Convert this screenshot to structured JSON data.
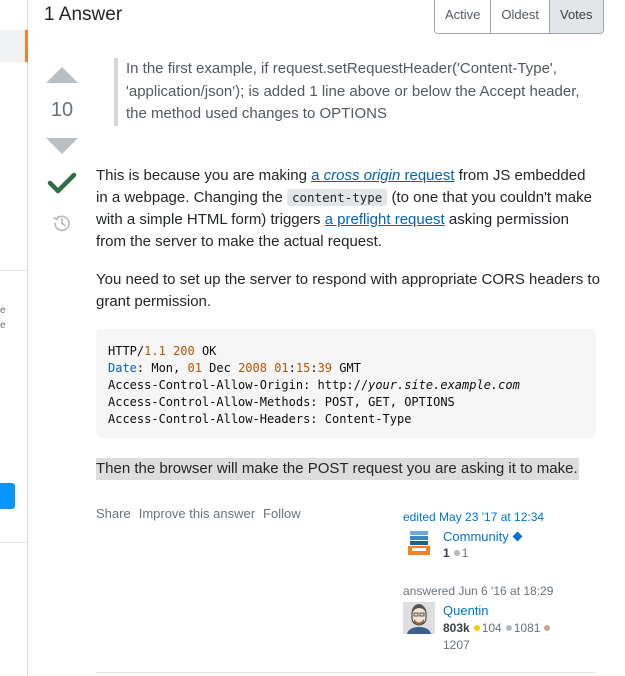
{
  "header": {
    "answers_count": "1 Answer",
    "sort_tabs": [
      "Active",
      "Oldest",
      "Votes"
    ],
    "selected_sort": "Votes"
  },
  "sidebar": {
    "fragment_1": "e",
    "fragment_2": "e"
  },
  "answer": {
    "score": "10",
    "accepted": true,
    "quote": "In the first example, if request.setRequestHeader('Content-Type', 'application/json'); is added 1 line above or below the Accept header, the method used changes to OPTIONS",
    "p1": {
      "t1": "This is because you are making ",
      "link1_a": "a ",
      "link1_em": "cross origin",
      "link1_b": " request",
      "t2": " from JS embedded in a webpage. Changing the ",
      "code": "content-type",
      "t3": " (to one that you couldn't make with a simple HTML form) triggers ",
      "link2": "a preflight request",
      "t4": " asking permission from the server to make the actual request."
    },
    "p2": "You need to set up the server to respond with appropriate CORS headers to grant permission.",
    "code_lines": {
      "l1_a": "HTTP/",
      "l1_b": "1.1",
      "l1_c": " ",
      "l1_d": "200",
      "l1_e": " OK",
      "l2_a": "Date",
      "l2_b": ": Mon, ",
      "l2_c": "01",
      "l2_d": " Dec ",
      "l2_e": "2008",
      "l2_f": " ",
      "l2_g": "01",
      "l2_h": ":",
      "l2_i": "15",
      "l2_j": ":",
      "l2_k": "39",
      "l2_l": " GMT",
      "l3": "Access-Control-Allow-Origin: http://",
      "l3_italic": "your.site.example.com",
      "l4": "Access-Control-Allow-Methods: POST, GET, OPTIONS",
      "l5": "Access-Control-Allow-Headers: Content-Type"
    },
    "p3": "Then the browser will make the POST request you are asking it to make."
  },
  "post_menu": {
    "share": "Share",
    "improve": "Improve this answer",
    "follow": "Follow"
  },
  "editor": {
    "edited": "edited May 23 '17 at 12:34",
    "name": "Community",
    "rep": "1",
    "silver": "1"
  },
  "author": {
    "answered": "answered Jun 6 '16 at 18:29",
    "name": "Quentin",
    "rep": "803k",
    "gold": "104",
    "silver": "1081",
    "bronze": "1207"
  },
  "colors": {
    "accent_orange": "#f48225",
    "link_blue": "#0063bf",
    "accepted_green": "#2f6f44"
  },
  "icons": [
    "vote-up-icon",
    "vote-down-icon",
    "accepted-check-icon",
    "history-icon",
    "diamond-icon"
  ]
}
